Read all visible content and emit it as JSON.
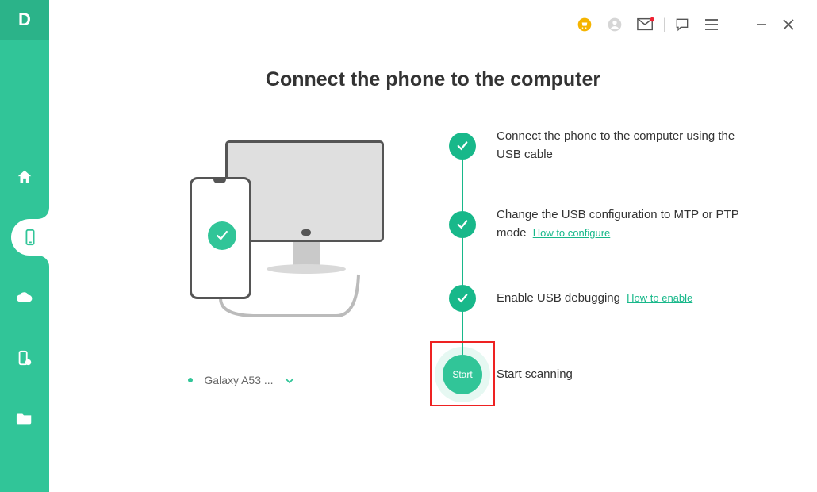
{
  "app": {
    "logo_letter": "D"
  },
  "titlebar": {
    "icons": [
      "cart",
      "user",
      "mail",
      "divider",
      "feedback",
      "menu",
      "minimize",
      "close"
    ]
  },
  "page": {
    "title": "Connect the phone to the computer"
  },
  "device": {
    "selected_name": "Galaxy A53 ..."
  },
  "steps": {
    "items": [
      {
        "text": "Connect the phone to the computer using the USB cable",
        "link": ""
      },
      {
        "text": "Change the USB configuration to MTP or PTP mode",
        "link": "How to configure"
      },
      {
        "text": "Enable USB debugging",
        "link": "How to enable"
      }
    ],
    "start_button_label": "Start",
    "start_scanning_label": "Start scanning"
  },
  "colors": {
    "accent": "#31c598",
    "accent_dark": "#18b88a"
  }
}
